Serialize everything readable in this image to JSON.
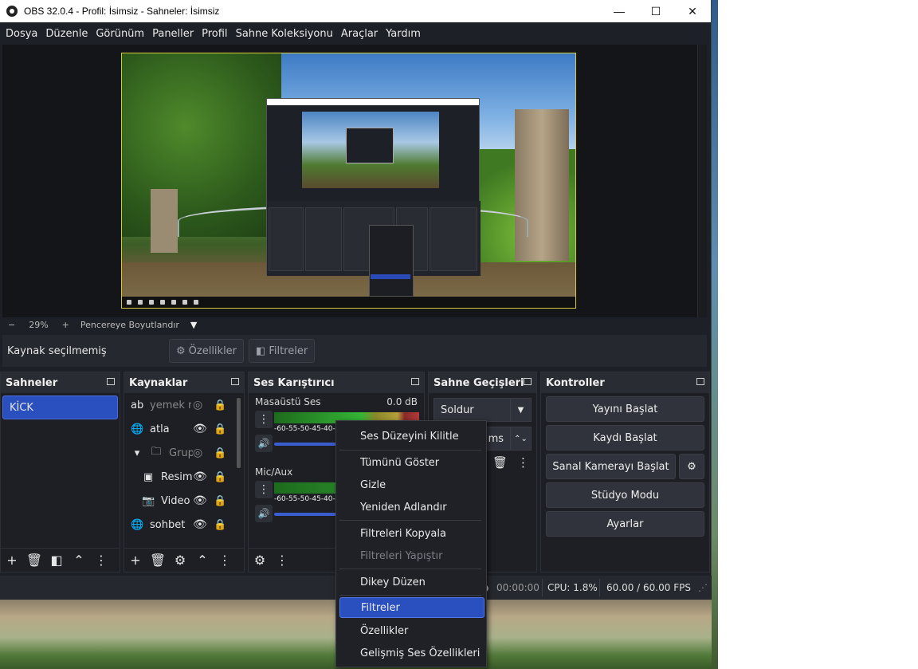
{
  "window": {
    "title": "OBS 32.0.4 - Profil: İsimsiz - Sahneler: İsimsiz",
    "minimize": "—",
    "maximize": "☐",
    "close": "✕"
  },
  "menu": [
    "Dosya",
    "Düzenle",
    "Görünüm",
    "Paneller",
    "Profil",
    "Sahne Koleksiyonu",
    "Araçlar",
    "Yardım"
  ],
  "zoom": {
    "minus": "−",
    "value": "29%",
    "plus": "+",
    "mode": "Pencereye Boyutlandır",
    "chevron": "▼"
  },
  "source_bar": {
    "label": "Kaynak seçilmemiş",
    "properties": "Özellikler",
    "filters": "Filtreler"
  },
  "scenes": {
    "title": "Sahneler",
    "items": [
      "KİCK"
    ]
  },
  "sources": {
    "title": "Kaynaklar",
    "items": [
      {
        "icon": "text-icon",
        "glyph": "ab",
        "name": "yemek r",
        "dim": true
      },
      {
        "icon": "globe-icon",
        "glyph": "🌐",
        "name": "atla",
        "dim": false
      },
      {
        "icon": "folder-icon",
        "glyph": "🗀",
        "name": "Grup",
        "dim": true
      },
      {
        "icon": "image-icon",
        "glyph": "▣",
        "name": "Resim",
        "dim": false
      },
      {
        "icon": "camera-icon",
        "glyph": "📷",
        "name": "Video",
        "dim": false
      },
      {
        "icon": "globe-icon",
        "glyph": "🌐",
        "name": "sohbet",
        "dim": false
      }
    ]
  },
  "mixer": {
    "title": "Ses Karıştırıcı",
    "channels": [
      {
        "name": "Masaüstü Ses",
        "db": "0.0 dB",
        "ticks": "-60-55-50-45-40-3"
      },
      {
        "name": "Mic/Aux",
        "db": "",
        "ticks": "-60-55-50-45-40-3"
      }
    ]
  },
  "transitions": {
    "title": "Sahne Geçişleri",
    "selected": "Soldur",
    "duration": "ms"
  },
  "controls": {
    "title": "Kontroller",
    "buttons": [
      "Yayını Başlat",
      "Kaydı Başlat",
      "Sanal Kamerayı Başlat",
      "Stüdyo Modu",
      "Ayarlar"
    ]
  },
  "status": {
    "time": "00:00:00",
    "cpu": "CPU: 1.8%",
    "fps": "60.00 / 60.00 FPS"
  },
  "context_menu": [
    {
      "label": "Ses Düzeyini Kilitle",
      "disabled": false,
      "highlight": false
    },
    {
      "label": "Tümünü Göster",
      "disabled": false,
      "highlight": false
    },
    {
      "label": "Gizle",
      "disabled": false,
      "highlight": false
    },
    {
      "label": "Yeniden Adlandır",
      "disabled": false,
      "highlight": false
    },
    {
      "label": "Filtreleri Kopyala",
      "disabled": false,
      "highlight": false
    },
    {
      "label": "Filtreleri Yapıştır",
      "disabled": true,
      "highlight": false
    },
    {
      "label": "Dikey Düzen",
      "disabled": false,
      "highlight": false
    },
    {
      "label": "Filtreler",
      "disabled": false,
      "highlight": true
    },
    {
      "label": "Özellikler",
      "disabled": false,
      "highlight": false
    },
    {
      "label": "Gelişmiş Ses Özellikleri",
      "disabled": false,
      "highlight": false
    }
  ],
  "colors": {
    "accent": "#2a50c0",
    "canvas_border": "#d7c93a",
    "bg": "#1e2027"
  }
}
